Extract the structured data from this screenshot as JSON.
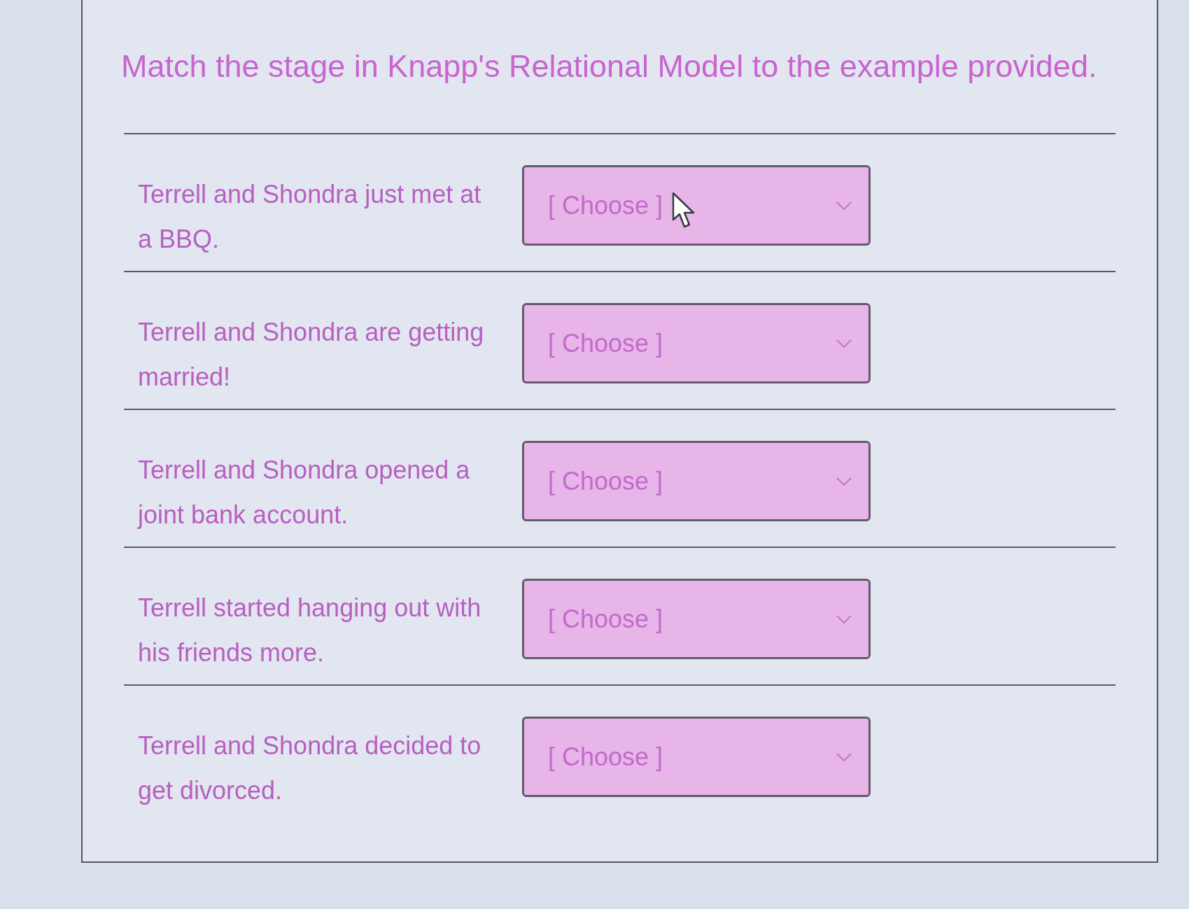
{
  "title": "Match the stage in Knapp's Relational Model to the example provided.",
  "items": [
    {
      "prompt": "Terrell and Shondra just met at a BBQ.",
      "answer": {
        "value": "[ Choose ]"
      },
      "pointer": true
    },
    {
      "prompt": "Terrell and Shondra are getting married!",
      "answer": {
        "value": "[ Choose ]"
      },
      "pointer": false
    },
    {
      "prompt": "Terrell and Shondra opened a joint bank account.",
      "answer": {
        "value": "[ Choose ]"
      },
      "pointer": false
    },
    {
      "prompt": "Terrell started hanging out with his friends more.",
      "answer": {
        "value": "[ Choose ]"
      },
      "pointer": false
    },
    {
      "prompt": "Terrell and Shondra decided to get divorced.",
      "answer": {
        "value": "[ Choose ]"
      },
      "pointer": false
    }
  ]
}
